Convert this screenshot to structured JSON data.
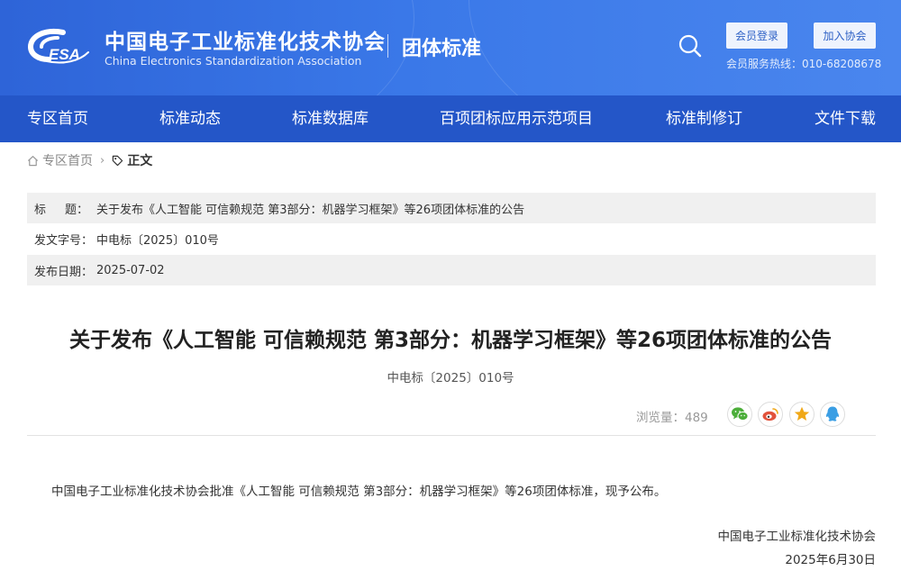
{
  "header": {
    "logo_text": "ESA",
    "site_title": "中国电子工业标准化技术协会",
    "site_subtitle": "China Electronics Standardization Association",
    "section_title": "团体标准",
    "login_button": "会员登录",
    "join_button": "加入协会",
    "hotline": "会员服务热线：010-68208678",
    "colors": {
      "header_bg": "#3a78e8",
      "nav_bg": "#2456c8"
    }
  },
  "nav": {
    "items": [
      "专区首页",
      "标准动态",
      "标准数据库",
      "百项团标应用示范项目",
      "标准制修订",
      "文件下载"
    ]
  },
  "breadcrumb": {
    "home": "专区首页",
    "current": "正文"
  },
  "meta": {
    "title_label_a": "标",
    "title_label_b": "题：",
    "title_value": "关于发布《人工智能 可信赖规范 第3部分：机器学习框架》等26项团体标准的公告",
    "docno_label": "发文字号：",
    "docno_value": "中电标〔2025〕010号",
    "date_label": "发布日期：",
    "date_value": "2025-07-02"
  },
  "article": {
    "title": "关于发布《人工智能 可信赖规范 第3部分：机器学习框架》等26项团体标准的公告",
    "doc_number": "中电标〔2025〕010号",
    "views": "浏览量：489",
    "body": "中国电子工业标准化技术协会批准《人工智能 可信赖规范 第3部分：机器学习框架》等26项团体标准，现予公布。",
    "signature_org": "中国电子工业标准化技术协会",
    "signature_date": "2025年6月30日"
  },
  "share": {
    "icons": [
      "wechat-icon",
      "weibo-icon",
      "favorite-icon",
      "qq-icon"
    ],
    "colors": {
      "wechat": "#4cae3a",
      "weibo": "#e2533c",
      "favorite": "#f0a818",
      "qq": "#3a9ee4"
    }
  }
}
